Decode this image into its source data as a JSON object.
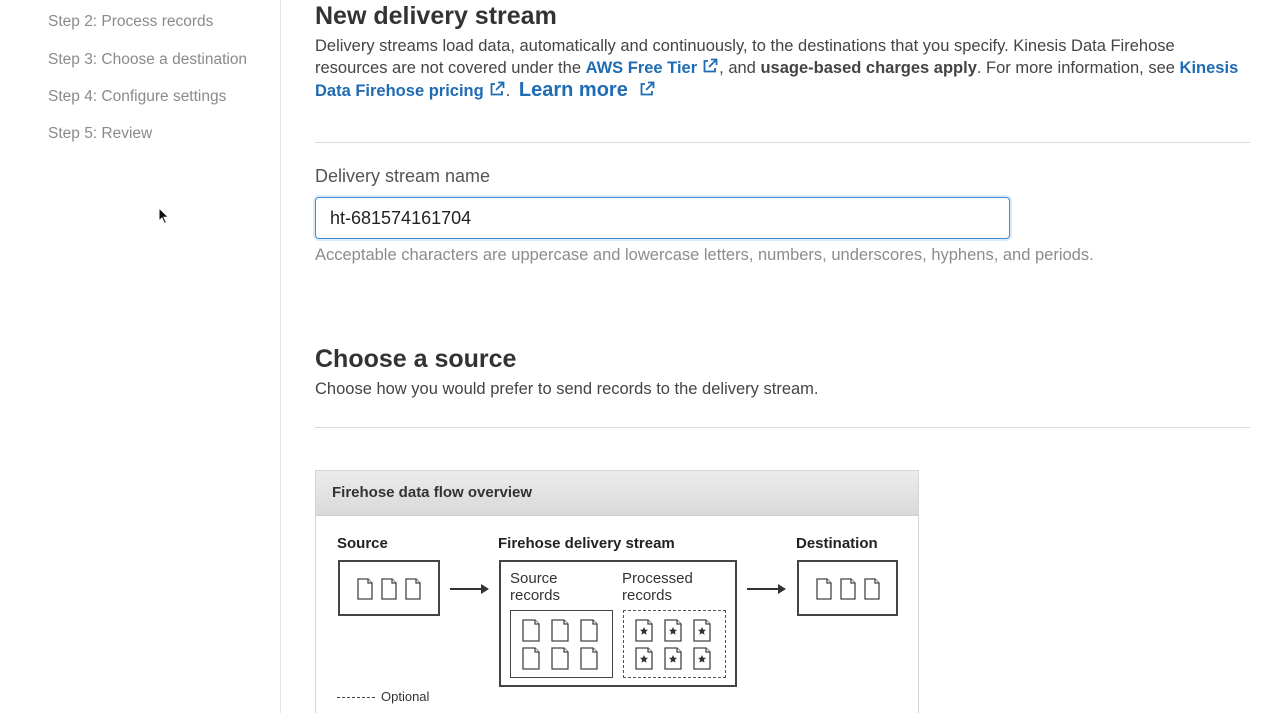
{
  "sidebar": {
    "steps": [
      {
        "label": "Step 2: Process records"
      },
      {
        "label": "Step 3: Choose a destination"
      },
      {
        "label": "Step 4: Configure settings"
      },
      {
        "label": "Step 5: Review"
      }
    ]
  },
  "header": {
    "title": "New delivery stream",
    "description_part1": "Delivery streams load data, automatically and continuously, to the destinations that you specify. Kinesis Data Firehose resources are not covered under the ",
    "free_tier_link": "AWS Free Tier",
    "description_part2": ", and ",
    "charges_bold": "usage-based charges apply",
    "description_part3": ". For more information, see ",
    "pricing_link": "Kinesis Data Firehose pricing",
    "description_part4": ".",
    "learn_more": "Learn more"
  },
  "stream_name": {
    "label": "Delivery stream name",
    "value": "ht-681574161704",
    "hint": "Acceptable characters are uppercase and lowercase letters, numbers, underscores, hyphens, and periods."
  },
  "source": {
    "title": "Choose a source",
    "description": "Choose how you would prefer to send records to the delivery stream."
  },
  "overview": {
    "title": "Firehose data flow overview",
    "source_label": "Source",
    "stream_label": "Firehose delivery stream",
    "destination_label": "Destination",
    "source_records": "Source records",
    "processed_records": "Processed records",
    "optional_label": "Optional"
  },
  "colors": {
    "link": "#1f6bb4",
    "input_border": "#3f8bd6",
    "muted_text": "#8a8a8a"
  }
}
